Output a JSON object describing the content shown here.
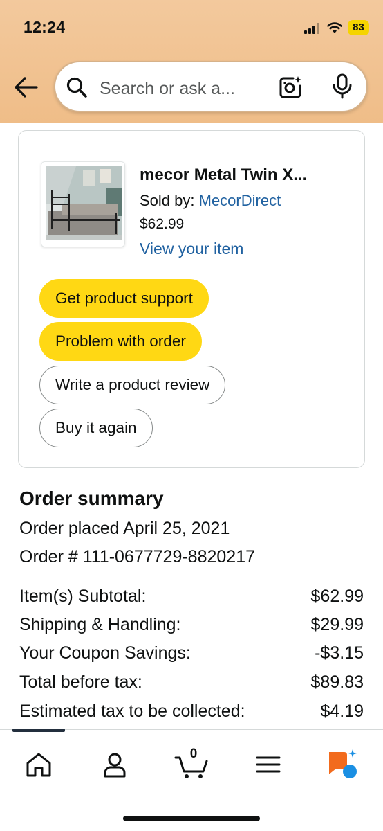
{
  "status_bar": {
    "time": "12:24",
    "battery": "83"
  },
  "search": {
    "placeholder": "Search or ask a..."
  },
  "product": {
    "title": "mecor Metal Twin X...",
    "sold_by_label": "Sold by:",
    "seller": "MecorDirect",
    "price": "$62.99",
    "view_link": "View your item"
  },
  "actions": {
    "support": "Get product support",
    "problem": "Problem with order",
    "review": "Write a product review",
    "buy_again": "Buy it again"
  },
  "summary": {
    "title": "Order summary",
    "placed": "Order placed April 25, 2021",
    "order_number": "Order # 111-0677729-8820217",
    "rows": [
      {
        "label": "Item(s) Subtotal:",
        "value": "$62.99"
      },
      {
        "label": "Shipping & Handling:",
        "value": "$29.99"
      },
      {
        "label": "Your Coupon Savings:",
        "value": "-$3.15"
      },
      {
        "label": "Total before tax:",
        "value": "$89.83"
      },
      {
        "label": "Estimated tax to be collected:",
        "value": "$4.19"
      }
    ]
  },
  "nav": {
    "cart_count": "0",
    "icons": [
      "home-icon",
      "account-icon",
      "cart-icon",
      "menu-icon",
      "rufus-icon"
    ]
  },
  "colors": {
    "header_bg": "#efbd88",
    "accent_yellow": "#ffd814",
    "link_blue": "#2162a1",
    "rufus_orange": "#f26b1d",
    "rufus_blue": "#1a8fe3"
  }
}
